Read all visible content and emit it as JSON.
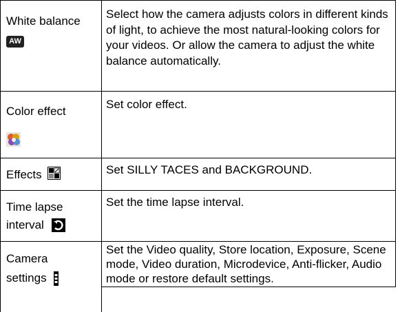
{
  "rows": [
    {
      "name": "White balance",
      "icon": "white-balance-auto-icon",
      "icon_text": "AW",
      "description": "Select how the camera adjusts colors in different kinds of light, to achieve the most natural-looking colors for your videos. Or allow the camera to adjust the white balance automatically."
    },
    {
      "name": "Color effect",
      "icon": "color-effect-icon",
      "description": "Set color effect."
    },
    {
      "name": "Effects",
      "icon": "effects-icon",
      "description": "Set SILLY TACES and BACKGROUND."
    },
    {
      "name_line1": "Time lapse",
      "name_line2": "interval",
      "icon": "time-lapse-icon",
      "description": "Set the time lapse interval."
    },
    {
      "name_line1": "Camera",
      "name_line2": "settings",
      "icon": "camera-settings-icon",
      "description": "Set the Video quality, Store location, Exposure, Scene mode, Video duration, Microdevice, Anti-flicker, Audio mode or restore default settings."
    }
  ]
}
